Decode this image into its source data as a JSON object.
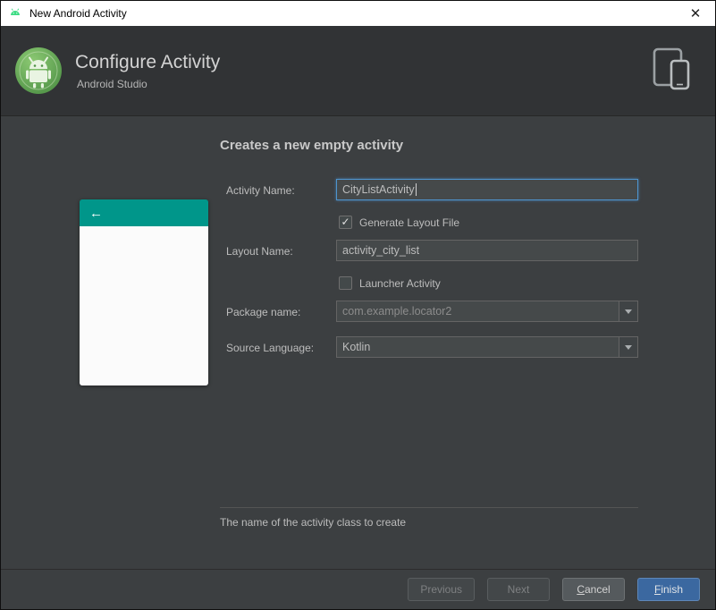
{
  "window": {
    "title": "New Android Activity",
    "close_glyph": "✕"
  },
  "banner": {
    "title": "Configure Activity",
    "subtitle": "Android Studio"
  },
  "form": {
    "heading": "Creates a new empty activity",
    "preview_back_glyph": "←",
    "activity_name": {
      "label": "Activity Name:",
      "value": "CityListActivity"
    },
    "generate_layout": {
      "label": "Generate Layout File",
      "checked": true,
      "check_glyph": "✓"
    },
    "layout_name": {
      "label": "Layout Name:",
      "value": "activity_city_list"
    },
    "launcher_activity": {
      "label": "Launcher Activity",
      "checked": false
    },
    "package_name": {
      "label": "Package name:",
      "value": "com.example.locator2"
    },
    "source_language": {
      "label": "Source Language:",
      "value": "Kotlin"
    },
    "hint": "The name of the activity class to create"
  },
  "buttons": {
    "previous": "Previous",
    "next": "Next",
    "cancel_mnemonic": "C",
    "cancel_rest": "ancel",
    "finish_mnemonic": "F",
    "finish_rest": "inish"
  },
  "colors": {
    "android_green": "#3ddc84",
    "preview_teal": "#00968a",
    "focus_blue": "#4e94ce",
    "primary_button_blue": "#3b68a0"
  }
}
